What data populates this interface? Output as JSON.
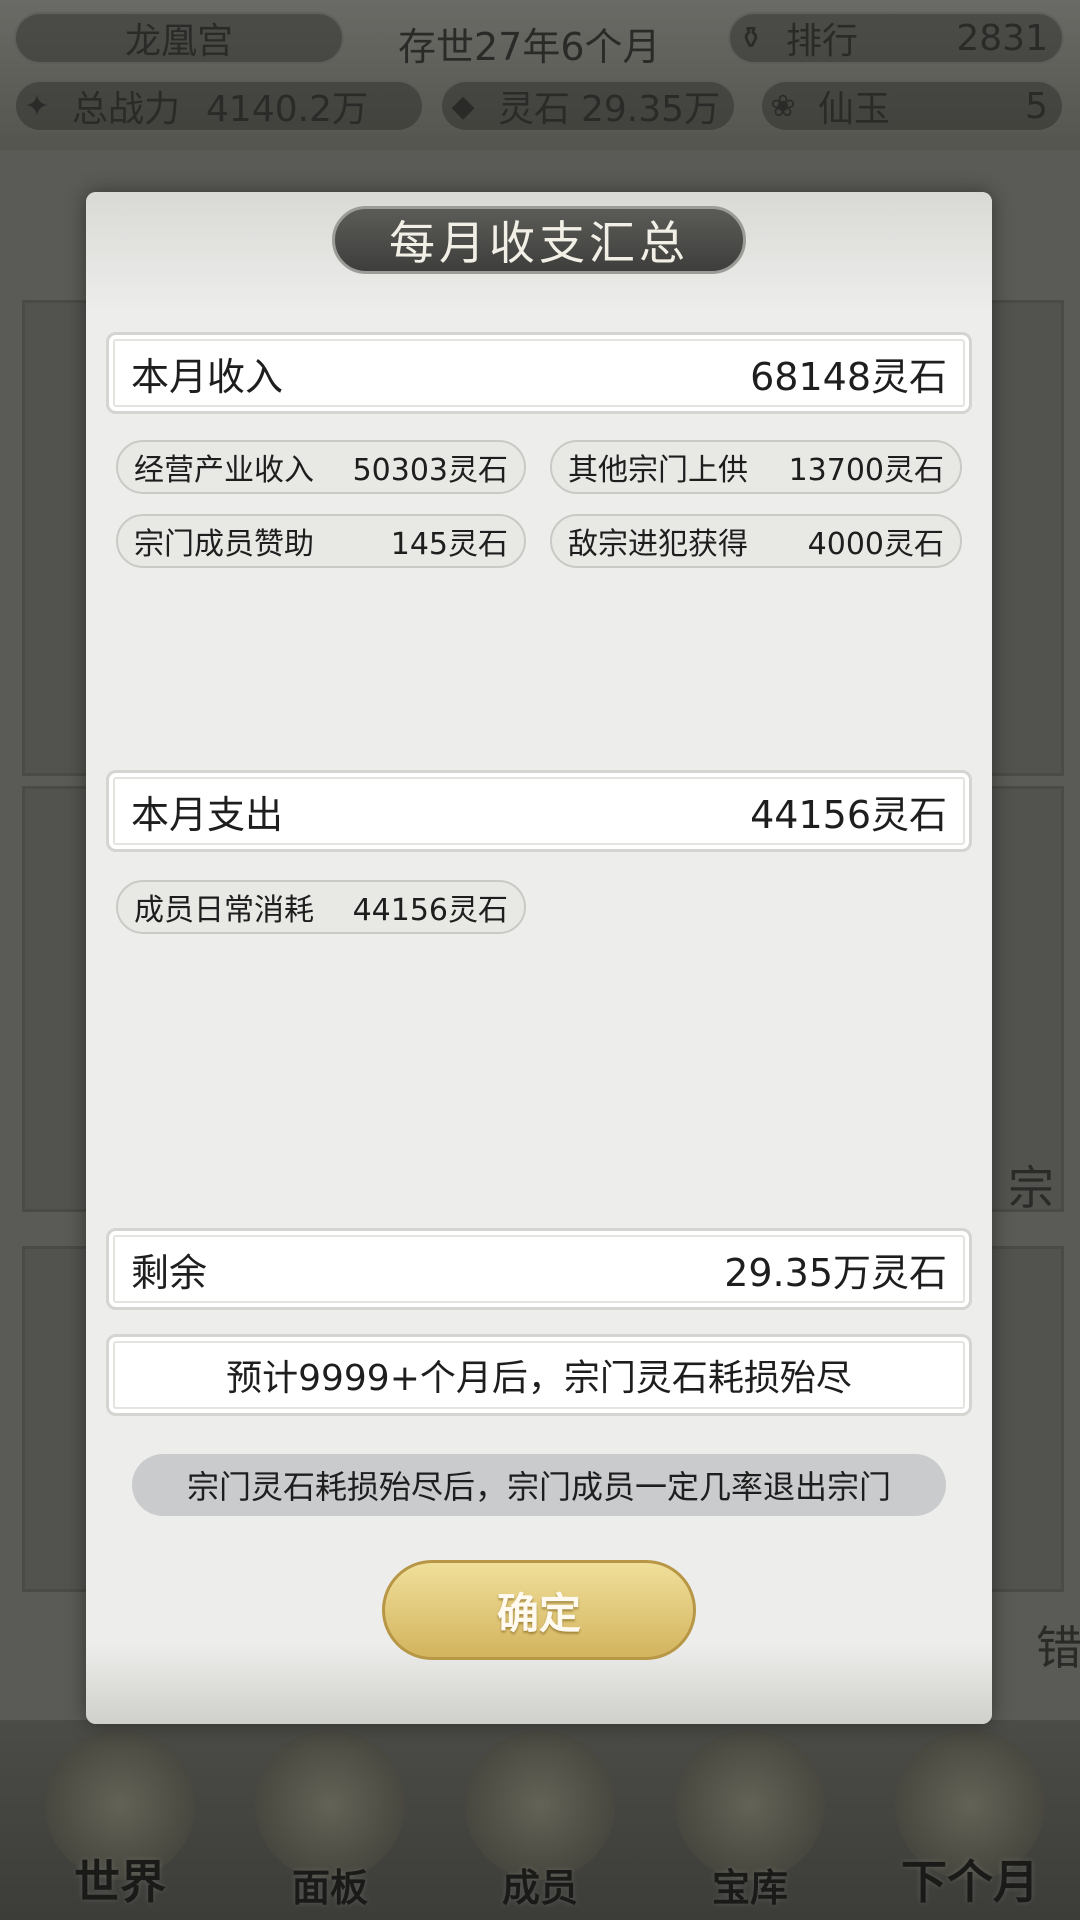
{
  "topbar": {
    "sect_name": "龙凰宫",
    "age": "存世27年6个月",
    "rank_label": "排行",
    "rank_value": "2831",
    "power_label": "总战力",
    "power_value": "4140.2万",
    "stone_label": "灵石",
    "stone_value": "29.35万",
    "jade_label": "仙玉",
    "jade_value": "5"
  },
  "modal": {
    "title": "每月收支汇总",
    "income": {
      "label": "本月收入",
      "value": "68148灵石",
      "items": [
        {
          "label": "经营产业收入",
          "value": "50303灵石"
        },
        {
          "label": "其他宗门上供",
          "value": "13700灵石"
        },
        {
          "label": "宗门成员赞助",
          "value": "145灵石"
        },
        {
          "label": "敌宗进犯获得",
          "value": "4000灵石"
        }
      ]
    },
    "expense": {
      "label": "本月支出",
      "value": "44156灵石",
      "items": [
        {
          "label": "成员日常消耗",
          "value": "44156灵石"
        }
      ]
    },
    "remain": {
      "label": "剩余",
      "value": "29.35万灵石"
    },
    "forecast": "预计9999+个月后，宗门灵石耗损殆尽",
    "warning": "宗门灵石耗损殆尽后，宗门成员一定几率退出宗门",
    "confirm": "确定"
  },
  "bg": {
    "side_right_1": "宗",
    "side_right_2": "错"
  },
  "nav": {
    "world": "世界",
    "panel": "面板",
    "members": "成员",
    "treasury": "宝库",
    "next_month": "下个月"
  }
}
